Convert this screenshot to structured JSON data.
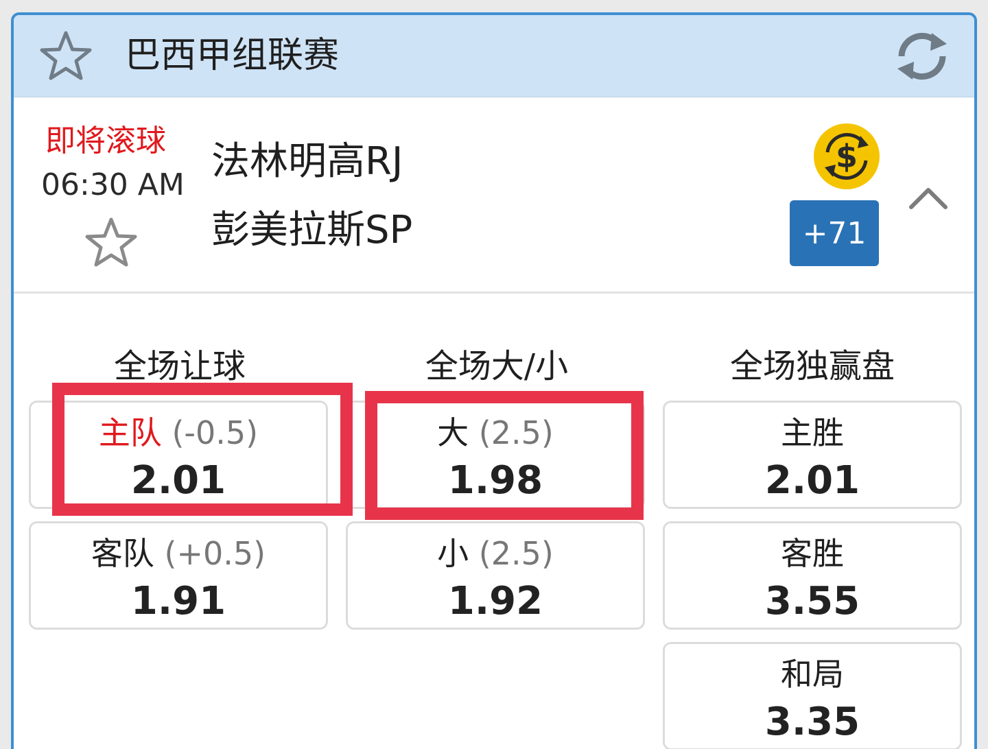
{
  "league": {
    "title": "巴西甲组联赛"
  },
  "match": {
    "status": "即将滚球",
    "time": "06:30 AM",
    "home_team": "法林明高RJ",
    "away_team": "彭美拉斯SP",
    "more_markets": "+71"
  },
  "markets": {
    "handicap": {
      "title": "全场让球",
      "home": {
        "label": "主队",
        "line": "(-0.5)",
        "odds": "2.01"
      },
      "away": {
        "label": "客队",
        "line": "(+0.5)",
        "odds": "1.91"
      }
    },
    "over_under": {
      "title": "全场大/小",
      "over": {
        "label": "大",
        "line": "(2.5)",
        "odds": "1.98"
      },
      "under": {
        "label": "小",
        "line": "(2.5)",
        "odds": "1.92"
      }
    },
    "moneyline": {
      "title": "全场独赢盘",
      "home": {
        "label": "主胜",
        "odds": "2.01"
      },
      "away": {
        "label": "客胜",
        "odds": "3.55"
      },
      "draw": {
        "label": "和局",
        "odds": "3.35"
      }
    }
  },
  "icons": {
    "league_star": "star-outline-icon",
    "refresh": "refresh-icon",
    "match_star": "star-outline-icon",
    "cashout": "cashout-dollar-icon",
    "collapse": "chevron-up-icon"
  },
  "colors": {
    "header_bg": "#cfe3f6",
    "border_blue": "#3f8fd2",
    "status_red": "#e0191e",
    "button_blue": "#2a72b6",
    "highlight_red": "#e8344a",
    "cashout_gold": "#f5c400"
  }
}
